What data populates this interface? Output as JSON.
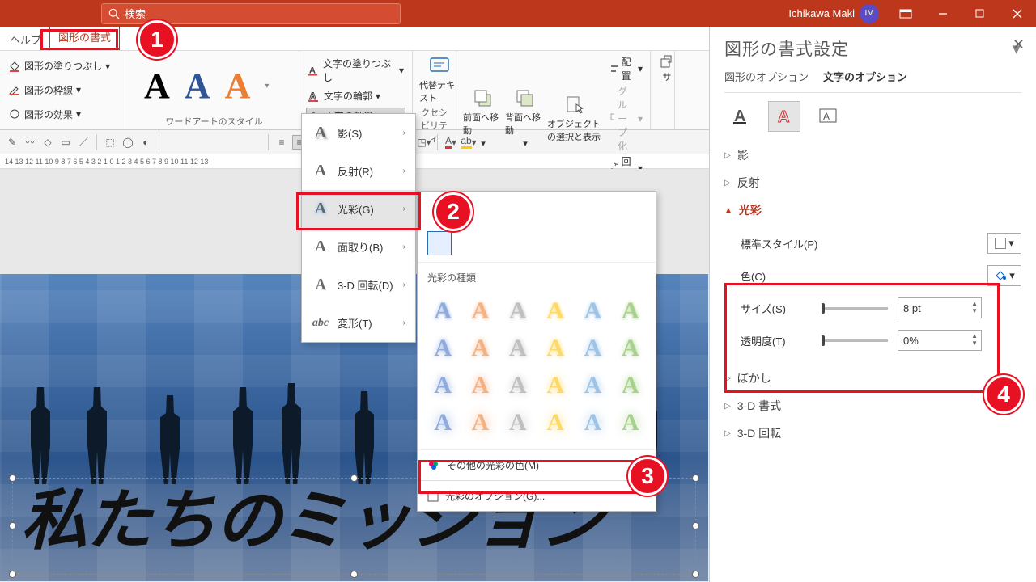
{
  "titlebar": {
    "search_placeholder": "検索",
    "user_name": "Ichikawa Maki",
    "avatar": "IM"
  },
  "tabs": {
    "help": "ヘルプ",
    "shape_format": "図形の書式"
  },
  "ribbon": {
    "shape_fill": "図形の塗りつぶし",
    "shape_outline": "図形の枠線",
    "shape_effects": "図形の効果",
    "wordart_group": "ワードアートのスタイル",
    "text_fill": "文字の塗りつぶし",
    "text_outline": "文字の輪郭",
    "text_effects": "文字の効果",
    "alt_text": "代替テキスト",
    "accessibility_group": "クセシビリティ",
    "bring_forward": "前面へ移動",
    "send_backward": "背面へ移動",
    "selection_pane": "オブジェクトの選択と表示",
    "arrange_group": "配置",
    "align": "配置",
    "group": "グループ化",
    "rotate": "回転",
    "size_icon": "サ"
  },
  "ruler_left": "14  13  12  11  10  9   8   7   6   5   4   3   2   1   0   1   2   3   4   5   6   7   8   9   10  11  12  13",
  "fx_menu": {
    "shadow": "影(S)",
    "reflection": "反射(R)",
    "glow": "光彩(G)",
    "bevel": "面取り(B)",
    "rotation3d": "3-D 回転(D)",
    "transform": "変形(T)"
  },
  "glow_gallery": {
    "header": "光彩の種類",
    "more_colors": "その他の光彩の色(M)",
    "options": "光彩のオプション(G)..."
  },
  "slide": {
    "mission_text": "私たちのミッション"
  },
  "pane": {
    "title": "図形の書式設定",
    "tab_shape": "図形のオプション",
    "tab_text": "文字のオプション",
    "sect_shadow": "影",
    "sect_reflection": "反射",
    "sect_glow": "光彩",
    "preset": "標準スタイル(P)",
    "color": "色(C)",
    "size": "サイズ(S)",
    "size_val": "8 pt",
    "transparency": "透明度(T)",
    "transparency_val": "0%",
    "sect_soft": "ぼかし",
    "sect_3dformat": "3-D 書式",
    "sect_3drot": "3-D 回転"
  },
  "callouts": {
    "c1": "1",
    "c2": "2",
    "c3": "3",
    "c4": "4"
  }
}
